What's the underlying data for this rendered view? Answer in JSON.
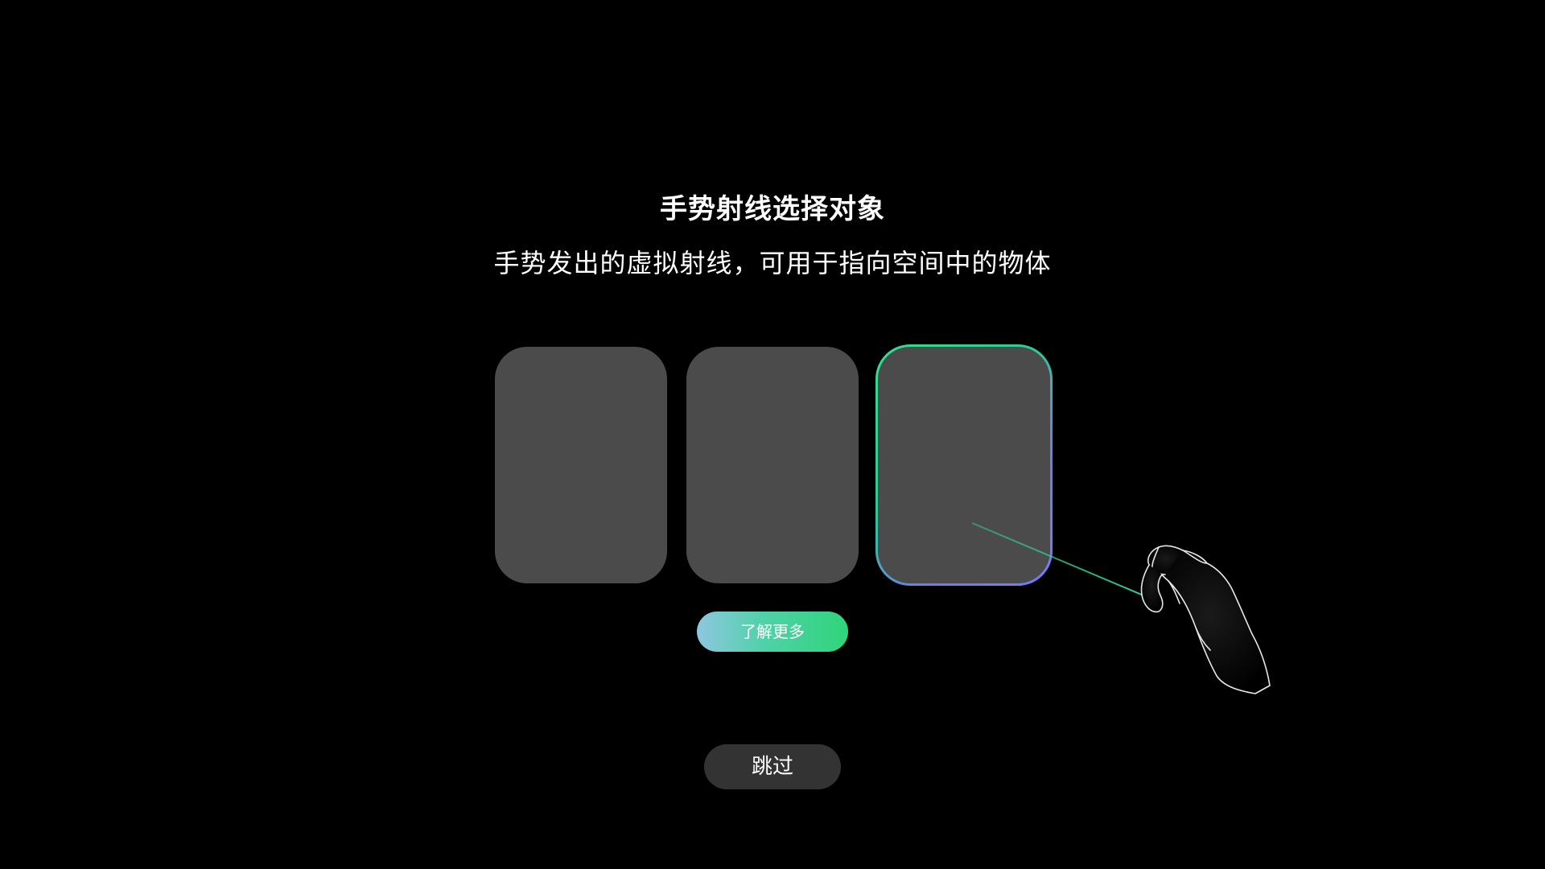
{
  "onboarding": {
    "title": "手势射线选择对象",
    "subtitle": "手势发出的虚拟射线，可用于指向空间中的物体",
    "learn_more_label": "了解更多",
    "skip_label": "跳过"
  },
  "cards": [
    {
      "state": "default"
    },
    {
      "state": "default"
    },
    {
      "state": "selected"
    }
  ],
  "colors": {
    "background": "#000000",
    "card": "#4b4b4b",
    "ray": "#2fd4a0",
    "accent_green": "#2fd47a",
    "accent_blue": "#7a7af5",
    "skip_button": "#333333"
  },
  "icons": {
    "hand": "pinch-hand-icon"
  }
}
